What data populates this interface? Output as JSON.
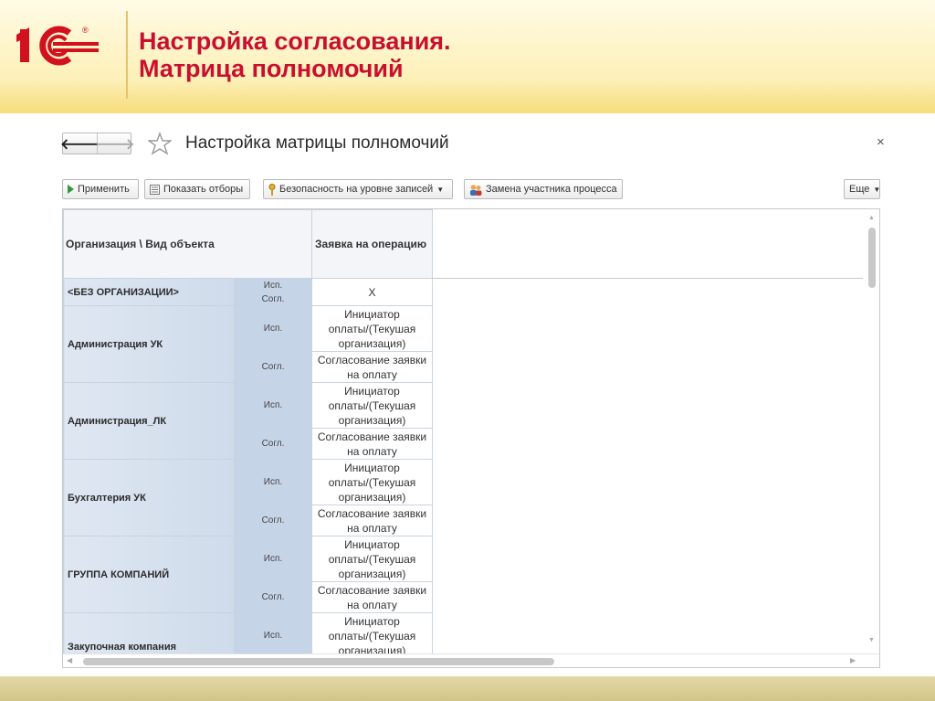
{
  "slide": {
    "title_line1": "Настройка согласования.",
    "title_line2": "Матрица полномочий",
    "logo_text": "1С",
    "logo_mark": "®",
    "brand_color": "#c8102e",
    "logo_color": "#d1121e"
  },
  "window": {
    "title": "Настройка матрицы полномочий",
    "nav_back_icon": "arrow-left-icon",
    "nav_forward_icon": "arrow-right-icon",
    "favorite_icon": "star-icon",
    "close_glyph": "×"
  },
  "toolbar": {
    "apply_label": "Применить",
    "show_filters_label": "Показать отборы",
    "record_security_label": "Безопасность на уровне записей",
    "replace_participant_label": "Замена участника процесса",
    "more_label": "Еще"
  },
  "table": {
    "header_org": "Организация \\ Вид объекта",
    "header_op": "Заявка на операцию",
    "rows": [
      {
        "org": "<БЕЗ ОРГАНИЗАЦИИ>",
        "exec_role": "Исп.",
        "approve_role": "Согл.",
        "value": "X"
      },
      {
        "org": "Администрация УК",
        "exec_role": "Исп.",
        "exec_value": "Инициатор оплаты/(Текушая организация)",
        "approve_role": "Согл.",
        "approve_value": "Согласование заявки на оплату"
      },
      {
        "org": "Администрация_ЛК",
        "exec_role": "Исп.",
        "exec_value": "Инициатор оплаты/(Текушая организация)",
        "approve_role": "Согл.",
        "approve_value": "Согласование заявки на оплату"
      },
      {
        "org": "Бухгалтерия УК",
        "exec_role": "Исп.",
        "exec_value": "Инициатор оплаты/(Текушая организация)",
        "approve_role": "Согл.",
        "approve_value": "Согласование заявки на оплату"
      },
      {
        "org": "ГРУППА КОМПАНИЙ",
        "exec_role": "Исп.",
        "exec_value": "Инициатор оплаты/(Текушая организация)",
        "approve_role": "Согл.",
        "approve_value": "Согласование заявки на оплату"
      },
      {
        "org": "Закупочная компания",
        "exec_role": "Исп.",
        "exec_value": "Инициатор оплаты/(Текушая организация)"
      }
    ]
  }
}
